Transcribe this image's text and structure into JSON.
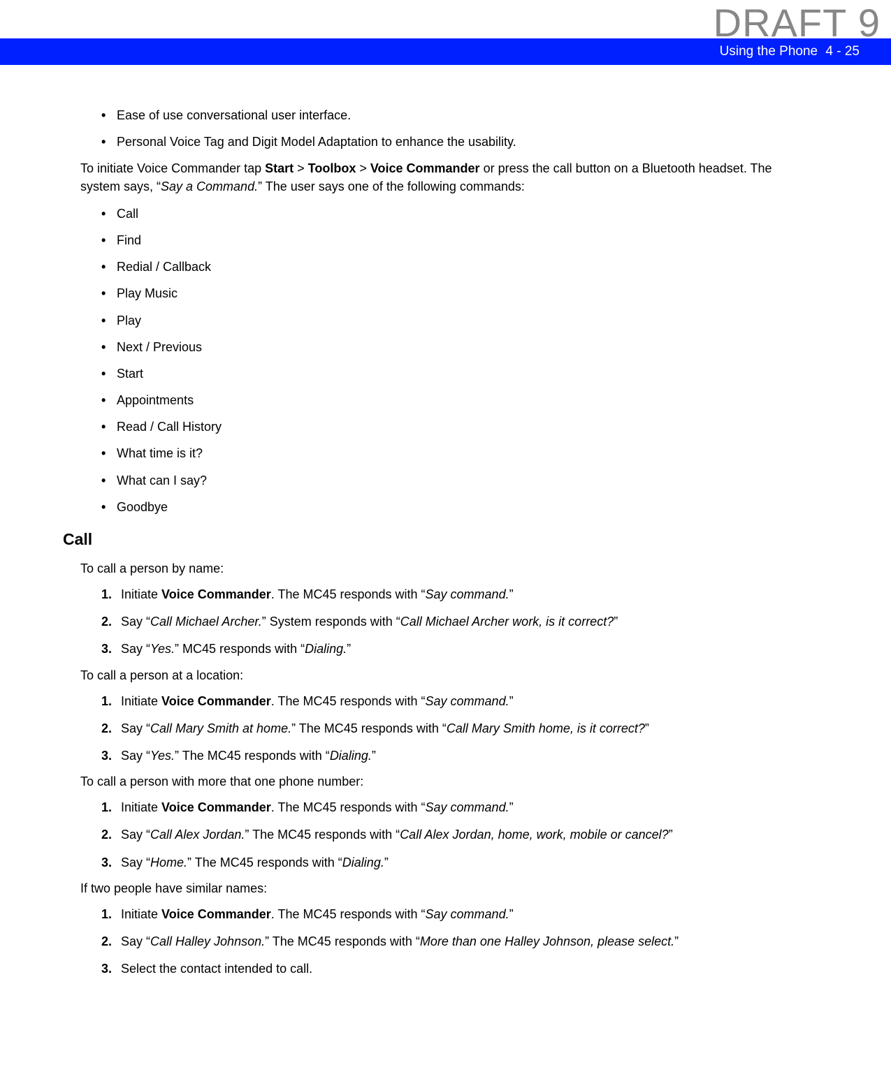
{
  "watermark": "DRAFT 9",
  "header": {
    "title": "Using the Phone",
    "page": "4 - 25"
  },
  "intro_bullets": [
    "Ease of use conversational user interface.",
    "Personal Voice Tag and Digit Model Adaptation to enhance the usability."
  ],
  "intro_para": {
    "pre": "To initiate Voice Commander tap ",
    "b1": "Start",
    "gt1": " > ",
    "b2": "Toolbox",
    "gt2": " > ",
    "b3": "Voice Commander",
    "mid": " or press the call button on a Bluetooth headset. The system says, “",
    "i1": "Say a Command.",
    "post": "” The user says one of the following commands:"
  },
  "command_bullets": [
    "Call",
    "Find",
    "Redial / Callback",
    "Play Music",
    "Play",
    "Next / Previous",
    "Start",
    "Appointments",
    "Read / Call History",
    "What time is it?",
    "What can I say?",
    "Goodbye"
  ],
  "section_heading": "Call",
  "call_name_intro": "To call a person by name:",
  "call_name_steps": [
    {
      "num": "1.",
      "pre": "Initiate ",
      "b": "Voice Commander",
      "mid": ". The MC45 responds with “",
      "i": "Say command.",
      "post": "”"
    },
    {
      "num": "2.",
      "pre": "Say “",
      "i": "Call Michael Archer.",
      "mid": "” System responds with “",
      "i2": "Call Michael Archer work, is it correct?",
      "post": "”"
    },
    {
      "num": "3.",
      "pre": "Say “",
      "i": "Yes.",
      "mid": "” MC45 responds with “",
      "i2": "Dialing.",
      "post": "”"
    }
  ],
  "call_location_intro": "To call a person at a location:",
  "call_location_steps": [
    {
      "num": "1.",
      "pre": "Initiate ",
      "b": "Voice Commander",
      "mid": ". The MC45 responds with “",
      "i": "Say command.",
      "post": "”"
    },
    {
      "num": "2.",
      "pre": "Say “",
      "i": "Call Mary Smith at home.",
      "mid": "” The MC45 responds with “",
      "i2": "Call Mary Smith home, is it correct?",
      "post": "”"
    },
    {
      "num": "3.",
      "pre": "Say “",
      "i": "Yes.",
      "mid": "” The MC45 responds with “",
      "i2": "Dialing.",
      "post": "”"
    }
  ],
  "call_multi_intro": "To call a person with more that one phone number:",
  "call_multi_steps": [
    {
      "num": "1.",
      "pre": "Initiate ",
      "b": "Voice Commander",
      "mid": ". The MC45 responds with “",
      "i": "Say command.",
      "post": "”"
    },
    {
      "num": "2.",
      "pre": "Say “",
      "i": "Call Alex Jordan.",
      "mid": "” The MC45 responds with “",
      "i2": "Call Alex Jordan, home, work, mobile or cancel?",
      "post": "”"
    },
    {
      "num": "3.",
      "pre": "Say “",
      "i": "Home.",
      "mid": "” The MC45 responds with “",
      "i2": "Dialing.",
      "post": "”"
    }
  ],
  "call_similar_intro": "If two people have similar names:",
  "call_similar_steps": [
    {
      "num": "1.",
      "pre": "Initiate ",
      "b": "Voice Commander",
      "mid": ". The MC45 responds with “",
      "i": "Say command.",
      "post": "”"
    },
    {
      "num": "2.",
      "pre": "Say “",
      "i": "Call Halley Johnson.",
      "mid": "” The MC45 responds with “",
      "i2": "More than one Halley Johnson, please select.",
      "post": "”"
    },
    {
      "num": "3.",
      "pre": "Select the contact intended to call."
    }
  ]
}
